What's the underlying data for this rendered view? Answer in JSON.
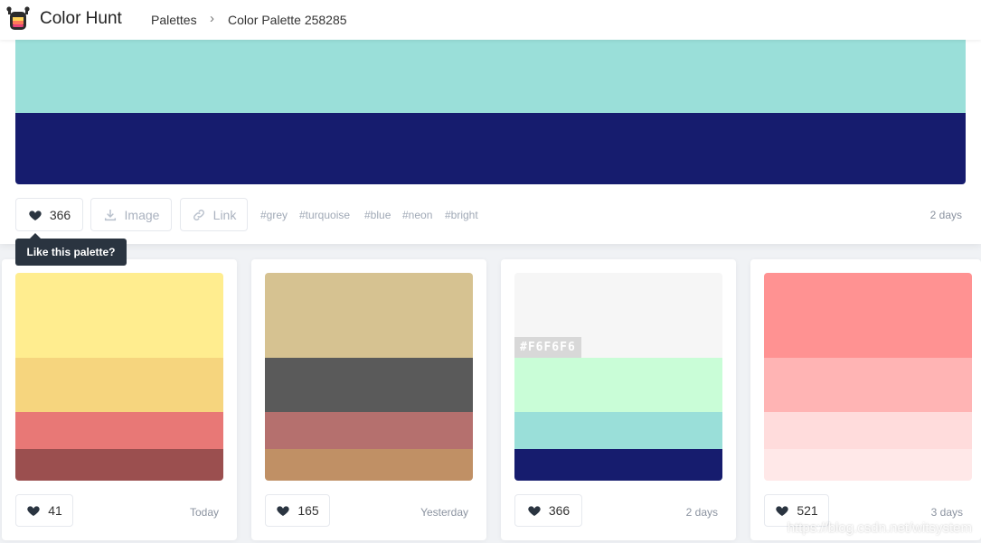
{
  "header": {
    "brand": "Color Hunt",
    "breadcrumb": [
      "Palettes",
      "Color Palette 258285"
    ],
    "separator": "›"
  },
  "top_palette": {
    "colors": [
      "#9ADFD9",
      "#161C6E"
    ],
    "likes": "366",
    "image_label": "Image",
    "link_label": "Link",
    "tags": [
      "#grey",
      "#turquoise",
      "#blue",
      "#neon",
      "#bright"
    ],
    "date": "2 days"
  },
  "tooltip": "Like this palette?",
  "cards": [
    {
      "colors": [
        "#FFED8F",
        "#F6D57E",
        "#E87876",
        "#9B4F4F"
      ],
      "likes": "41",
      "date": "Today",
      "hex_label": ""
    },
    {
      "colors": [
        "#D6C291",
        "#5A5A5A",
        "#B5706E",
        "#C09065"
      ],
      "likes": "165",
      "date": "Yesterday",
      "hex_label": ""
    },
    {
      "colors": [
        "#F6F6F6",
        "#C9FDD7",
        "#9ADFD9",
        "#161C6E"
      ],
      "likes": "366",
      "date": "2 days",
      "hex_label": "#F6F6F6"
    },
    {
      "colors": [
        "#FF9292",
        "#FFB4B4",
        "#FFDCDC",
        "#FFE8E8"
      ],
      "likes": "521",
      "date": "3 days",
      "hex_label": ""
    }
  ],
  "watermark": "https://blog.csdn.net/witsystem",
  "icons": [
    "logo-icon",
    "heart-icon",
    "download-icon",
    "link-icon"
  ]
}
